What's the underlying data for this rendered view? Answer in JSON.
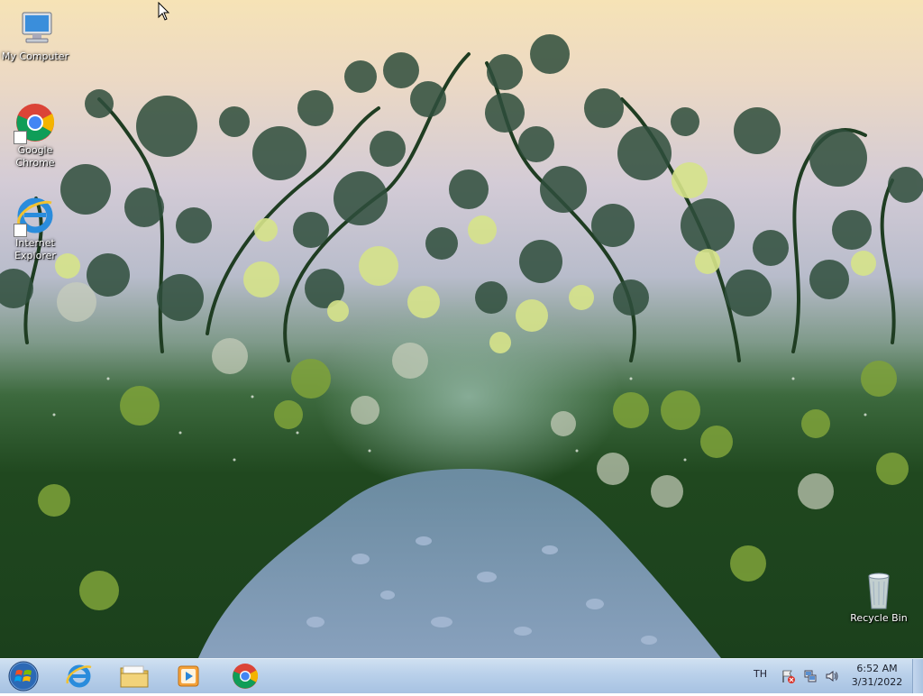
{
  "desktop": {
    "icons": [
      {
        "label": "My Computer",
        "icon": "my-computer-icon"
      },
      {
        "label": "Google Chrome",
        "icon": "chrome-icon",
        "shortcut": true
      },
      {
        "label": "Internet Explorer",
        "icon": "internet-explorer-icon",
        "shortcut": true
      },
      {
        "label": "Recycle Bin",
        "icon": "recycle-bin-icon"
      }
    ]
  },
  "taskbar": {
    "start": "start-orb-icon",
    "pinned": [
      {
        "name": "Internet Explorer",
        "icon": "internet-explorer-icon"
      },
      {
        "name": "Windows Explorer",
        "icon": "folder-icon"
      },
      {
        "name": "Windows Media Player",
        "icon": "media-player-icon"
      },
      {
        "name": "Google Chrome",
        "icon": "chrome-icon"
      }
    ],
    "tray": {
      "language": "TH",
      "icons": [
        "action-center-flag-icon",
        "network-icon",
        "volume-icon"
      ],
      "time": "6:52 AM",
      "date": "3/31/2022"
    }
  },
  "colors": {
    "taskbar": "#b9d0ea",
    "sky_top": "#f6e3b6",
    "foliage": "#20481f"
  }
}
